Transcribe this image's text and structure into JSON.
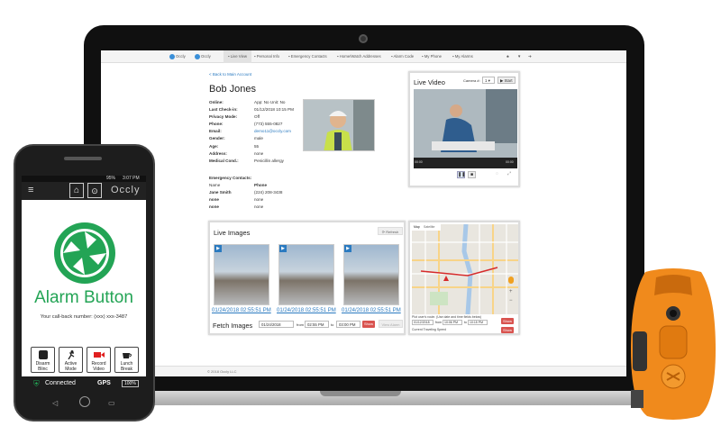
{
  "nav": {
    "brand1": "Occly",
    "brand2": "Occly",
    "tabs": [
      "Live View",
      "Personal Info",
      "Emergency Contacts",
      "Home/Watch Addresses",
      "Alarm Code",
      "My Phone",
      "My Alarms"
    ]
  },
  "profile": {
    "back_link": "< Back to Main Account",
    "name": "Bob Jones",
    "rows": [
      {
        "label": "Online:",
        "value": "App: No    Unit: No"
      },
      {
        "label": "Last Check-in:",
        "value": "01/12/2018 10:15 PM"
      },
      {
        "label": "Privacy Mode:",
        "value": "Off"
      },
      {
        "label": "Phone:",
        "value": "(773) 555-0827"
      },
      {
        "label": "Email:",
        "value": "demo11@occly.com"
      },
      {
        "label": "Gender:",
        "value": "male"
      },
      {
        "label": "Age:",
        "value": "55"
      },
      {
        "label": "Address:",
        "value": "none"
      },
      {
        "label": "Medical Cond.:",
        "value": "Penicillin allergy"
      }
    ],
    "emergency_title": "Emergency Contacts:",
    "contacts_header": {
      "name": "Name",
      "phone": "Phone"
    },
    "contacts": [
      {
        "name": "Jane Smith",
        "phone": "(224) 208-3438"
      },
      {
        "name": "none",
        "phone": "none"
      },
      {
        "name": "none",
        "phone": "none"
      }
    ]
  },
  "live_video": {
    "title": "Live Video",
    "camera_label": "Camera #:",
    "camera_value": "1",
    "start_label": "Start",
    "time_start": "00:00",
    "time_end": "00:00"
  },
  "live_images": {
    "title": "Live Images",
    "refresh_label": "Refresh",
    "timestamps": [
      "01/24/2018 02:55:51 PM",
      "01/24/2018 02:55:51 PM",
      "01/24/2018 02:55:51 PM"
    ],
    "fetch_label": "Fetch Images",
    "date": "01/24/2018",
    "from_label": "from",
    "from_time": "02:55 PM",
    "to_label": "to",
    "to_time": "03:00 PM",
    "show_label": "Show",
    "view_alarm_label": "View Alarm"
  },
  "map": {
    "tab_map": "Map",
    "tab_satellite": "Satellite",
    "route_note": "Plot user's route. (Use date and time fields below)",
    "date": "01/12/2018",
    "from_label": "from",
    "from_time": "10:06 PM",
    "to_label": "to",
    "to_time": "10:15 PM",
    "show_label": "Show",
    "speed_label": "Current Traveling Speed",
    "speed_show_label": "Show"
  },
  "footer_text": "© 2018 Occly LLC",
  "phone": {
    "status_time": "3:07 PM",
    "status_battery": "95%",
    "brand": "Occly",
    "app_title": "Alarm Button",
    "callback": "Your call-back number: (xxx) xxx-3487",
    "buttons": [
      {
        "l1": "Disarm",
        "l2": "Blinc"
      },
      {
        "l1": "Active",
        "l2": "Mode"
      },
      {
        "l1": "Record",
        "l2": "Video"
      },
      {
        "l1": "Lunch",
        "l2": "Break"
      }
    ],
    "connected": "Connected",
    "gps": "GPS",
    "battery": "100%"
  },
  "colors": {
    "accent": "#2a7ac0",
    "brand_green": "#23a455",
    "danger": "#d9534f",
    "device_orange": "#f08a1c"
  }
}
